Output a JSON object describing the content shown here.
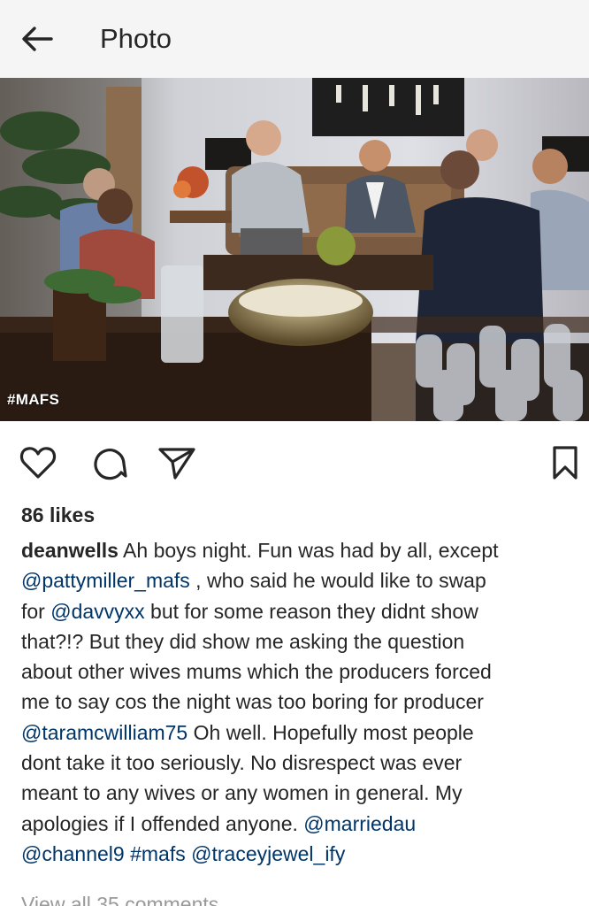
{
  "header": {
    "title": "Photo"
  },
  "photo": {
    "hashtag_overlay": "#MAFS"
  },
  "post": {
    "likes": "86 likes",
    "username": "deanwells",
    "caption_lines": [
      [
        {
          "t": "user",
          "v": "deanwells"
        },
        {
          "t": "text",
          "v": " Ah boys night. Fun was had by all, except"
        }
      ],
      [
        {
          "t": "mention",
          "v": "@pattymiller_mafs"
        },
        {
          "t": "text",
          "v": " , who said he would like to swap"
        }
      ],
      [
        {
          "t": "text",
          "v": "for "
        },
        {
          "t": "mention",
          "v": "@davvyxx"
        },
        {
          "t": "text",
          "v": " but for some reason they didnt show"
        }
      ],
      [
        {
          "t": "text",
          "v": "that?!? But they did show me asking the question"
        }
      ],
      [
        {
          "t": "text",
          "v": "about other wives mums which the producers forced"
        }
      ],
      [
        {
          "t": "text",
          "v": "me to say cos the night was too boring for producer"
        }
      ],
      [
        {
          "t": "mention",
          "v": "@taramcwilliam75"
        },
        {
          "t": "text",
          "v": " Oh well. Hopefully most people"
        }
      ],
      [
        {
          "t": "text",
          "v": "dont take it too seriously.  No disrespect was ever"
        }
      ],
      [
        {
          "t": "text",
          "v": "meant to any wives or any women in general. My"
        }
      ],
      [
        {
          "t": "text",
          "v": "apologies if I offended anyone. "
        },
        {
          "t": "mention",
          "v": "@marriedau"
        }
      ],
      [
        {
          "t": "mention",
          "v": "@channel9"
        },
        {
          "t": "text",
          "v": " "
        },
        {
          "t": "mention",
          "v": "#mafs"
        },
        {
          "t": "text",
          "v": " "
        },
        {
          "t": "mention",
          "v": "@traceyjewel_ify"
        }
      ]
    ],
    "view_comments": "View all 35 comments"
  },
  "colors": {
    "link": "#003569",
    "text": "#262626",
    "muted": "#999999",
    "topbar_bg": "#f5f5f5"
  },
  "icons": {
    "back": "arrow-left-icon",
    "like": "heart-icon",
    "comment": "comment-bubble-icon",
    "share": "paper-plane-icon",
    "save": "bookmark-icon"
  }
}
